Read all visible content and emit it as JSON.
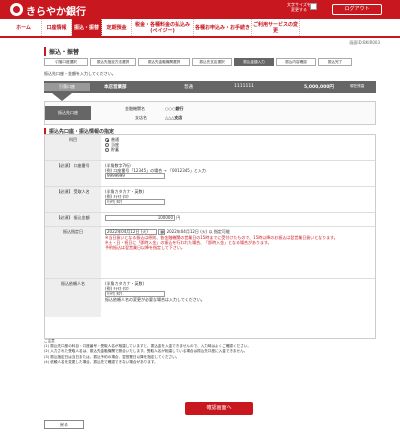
{
  "header": {
    "logo_text": "きらやか銀行",
    "font_size_label": "文字サイズを 変更する",
    "logout_label": "ログアウト"
  },
  "nav": {
    "items": [
      {
        "label": "ホーム"
      },
      {
        "label": "口座情報"
      },
      {
        "label": "振込・振替"
      },
      {
        "label": "定期預金"
      },
      {
        "label": "税金・各種料金の払込み(ペイジー)"
      },
      {
        "label": "各種お申込み・お手続き"
      },
      {
        "label": "ご利用サービスの変更"
      }
    ]
  },
  "page": {
    "info_text": "画面ID:BKIR003",
    "title": "振込・振替",
    "steps": [
      "引落口座選択",
      "振込先指定方法選択",
      "振込先金融機関選択",
      "振込先支店選択",
      "振込金額入力",
      "振込内容確認",
      "振込完了"
    ],
    "step_desc": "振込先口座・金額を入力してください。",
    "from_account": {
      "label": "引落口座",
      "branch": "本店営業部",
      "type": "普通",
      "number": "1111111",
      "balance": "5,000,000円",
      "balance_label": "現在残高"
    },
    "to_account": {
      "label": "振込先口座",
      "bank_label": "金融機関名",
      "bank_value": "○○○銀行",
      "branch_label": "支店名",
      "branch_value": "△△△支店"
    },
    "section_title": "振込先口座・振込情報の指定",
    "form": {
      "subject_label": "科目",
      "subject_options": [
        "普通",
        "当座",
        "貯蓄"
      ],
      "acct_label": "【必須】 口座番号",
      "acct_hint": "(半角数字7桁)",
      "acct_example": "(例) 口座番号「12345」の場合 → 「0012345」と入力",
      "acct_value": "9999999",
      "recipient_label": "【必須】 受取人名",
      "recipient_hint": "(半角カタカナ・英数)",
      "recipient_example": "(例) ｷﾗﾔｶ ﾀﾛｳ",
      "recipient_value": "ｷﾗﾔｶ ﾀﾛｳ",
      "amount_label": "【必須】 振込金額",
      "amount_value": "100000",
      "amount_unit": "円",
      "date_label": "振込指定日",
      "date_value": "2022年04月12日 (火)",
      "date_note": "2022年04月12日 (火) 以 指定可能",
      "date_warn1": "※当日扱いとなる振込は原則、各金融機関の営業日の15時までに受付けたもので、15時以降のお振込は翌営業日扱いとなります。",
      "date_warn2": "※土・日・祝日に「即時入金」の振込を行われた場合、「即時入金」となる場合があります。",
      "date_warn3": "予約振込は翌営業日以降を指定して下さい。",
      "requester_label": "振込依頼人名",
      "requester_hint": "(半角カタカナ・英数)",
      "requester_example": "(例) ｷﾗﾔｶ ﾀﾛｳ",
      "requester_value": "ｷﾗﾔｶ ﾀﾛｳ",
      "requester_note": "振込依頼人名の変更が必要な場合は入力してください。"
    },
    "notes_title": "ご注意",
    "notes": [
      "(1) 振込先口座の科目・口座番号・受取人名が相違していますと、振込金を入金できませんので、入力時はよくご確認ください。",
      "(2) 入力された受取人名は、振込先金融機関で照合いたします。受取人名が相違している場合は振込先口座に入金できません。",
      "(3) 振込指定日は当日または、振込予約の場合、翌営業日以降を指定してください。",
      "(4) 依頼人名を変更した場合、振込先で確認できない場合があります。"
    ],
    "confirm_label": "確認画面へ",
    "back_label": "戻る"
  }
}
